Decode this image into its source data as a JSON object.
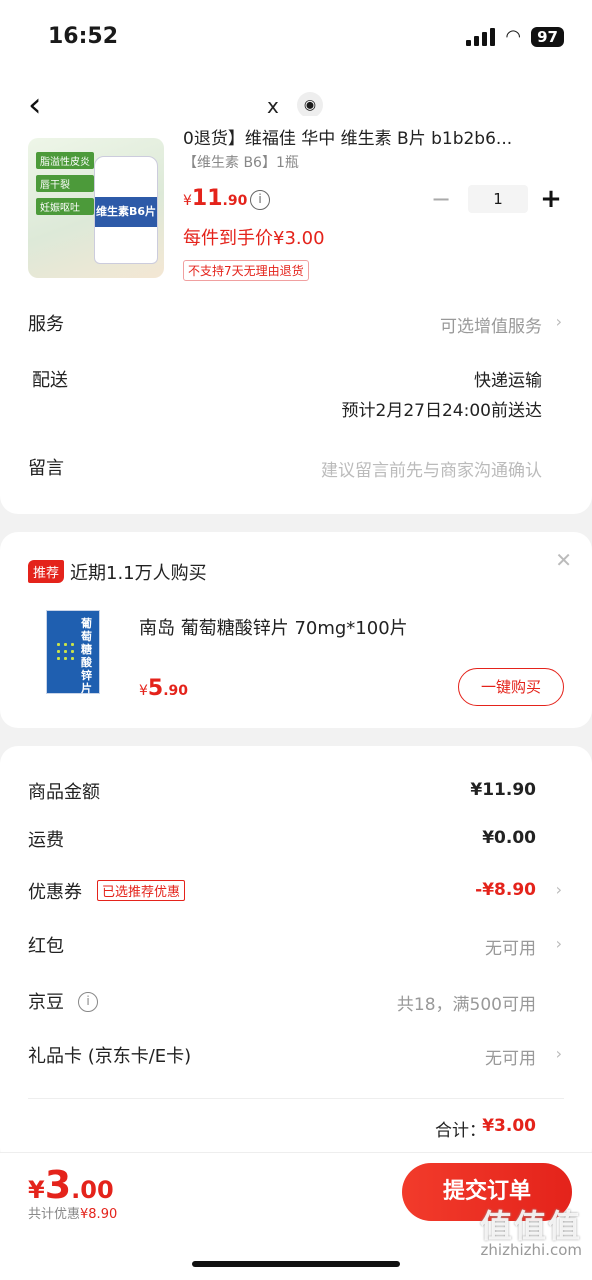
{
  "status_bar": {
    "time": "16:52",
    "battery": "97"
  },
  "nav": {
    "close_text": "x"
  },
  "product": {
    "title": "0退货】维福佳 华中 维生素 B片 b1b2b6...",
    "spec": "【维生素 B6】1瓶",
    "price_yen": "¥",
    "price_int": "11",
    "price_dec": ".90",
    "quantity": "1",
    "unit_price_text": "每件到手价¥3.00",
    "return_policy": "不支持7天无理由退货",
    "image_tags": [
      "脂溢性皮炎",
      "唇干裂",
      "妊娠呕吐"
    ],
    "image_label": "维生素B6片"
  },
  "service": {
    "label": "服务",
    "value": "可选增值服务"
  },
  "delivery": {
    "label": "配送",
    "method": "快递运输",
    "eta": "预计2月27日24:00前送达"
  },
  "message": {
    "label": "留言",
    "placeholder": "建议留言前先与商家沟通确认"
  },
  "recommend": {
    "badge": "推荐",
    "title": "近期1.1万人购买",
    "name": "南岛 葡萄糖酸锌片 70mg*100片",
    "price_yen": "¥",
    "price_int": "5",
    "price_dec": ".90",
    "buy_label": "一键购买",
    "image_text": "葡萄糖酸锌片"
  },
  "summary": {
    "goods_label": "商品金额",
    "goods_value": "¥11.90",
    "shipping_label": "运费",
    "shipping_value": "¥0.00",
    "coupon_label": "优惠券",
    "coupon_tag": "已选推荐优惠",
    "coupon_value": "-¥8.90",
    "redpacket_label": "红包",
    "redpacket_value": "无可用",
    "jd_bean_label": "京豆",
    "jd_bean_value": "共18，满500可用",
    "giftcard_label": "礼品卡 (京东卡/E卡)",
    "giftcard_value": "无可用",
    "total_label": "合计：",
    "total_value": "¥3.00"
  },
  "bottom": {
    "price_yen": "¥",
    "price_int": "3",
    "price_dec": ".00",
    "discount_label": "共计优惠",
    "discount_value": "¥8.90",
    "submit_label": "提交订单",
    "watermark": "值值值",
    "watermark_sub": "zhizhizhi.com"
  }
}
